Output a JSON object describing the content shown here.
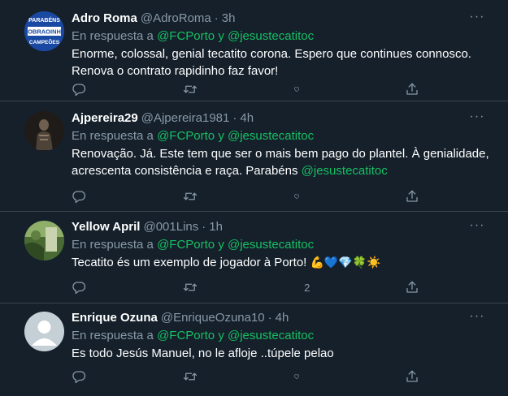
{
  "tweets": [
    {
      "name": "Adro Roma",
      "handle": "@AdroRoma",
      "separator": "·",
      "time": "3h",
      "reply_prefix": "En respuesta a ",
      "reply_to": "@FCPorto y @jesustecatitoc",
      "text": "Enorme, colossal, genial tecatito corona. Espero que continues connosco. Renova o contrato rapidinho faz favor!",
      "avatar_lines": [
        "PARABÉNS",
        "OBRAOINH",
        "CAMPEÕES"
      ],
      "likes": ""
    },
    {
      "name": "Ajpereira29",
      "handle": "@Ajpereira1981",
      "separator": "·",
      "time": "4h",
      "reply_prefix": "En respuesta a ",
      "reply_to": "@FCPorto y @jesustecatitoc",
      "text": "Renovação. Já. Este tem que ser o mais bem pago do plantel. À genialidade, acrescenta consistência e raça. Parabéns ",
      "mention": "@jesustecatitoc",
      "likes": ""
    },
    {
      "name": "Yellow April",
      "handle": "@001Lins",
      "separator": "·",
      "time": "1h",
      "reply_prefix": "En respuesta a ",
      "reply_to": "@FCPorto y @jesustecatitoc",
      "text": "Tecatito és um exemplo de jogador à Porto! ",
      "emojis": "💪💙💎🍀☀️",
      "likes": "2"
    },
    {
      "name": "Enrique Ozuna",
      "handle": "@EnriqueOzuna10",
      "separator": "·",
      "time": "4h",
      "reply_prefix": "En respuesta a ",
      "reply_to": "@FCPorto y @jesustecatitoc",
      "text": "Es todo Jesús Manuel, no le afloje ..túpele pelao",
      "likes": ""
    }
  ],
  "more_glyph": "···",
  "colors": {
    "background": "#15202b",
    "muted": "#8899a6",
    "accent_green": "#17bf63",
    "divider": "#38444d"
  },
  "icons": [
    "reply-icon",
    "retweet-icon",
    "like-icon",
    "share-icon"
  ]
}
